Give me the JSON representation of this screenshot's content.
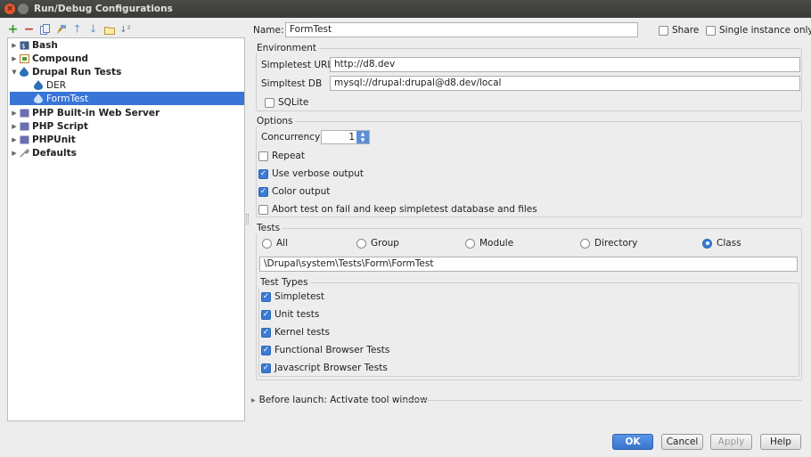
{
  "window": {
    "title": "Run/Debug Configurations"
  },
  "toolbar": {
    "icons": [
      "add-icon",
      "remove-icon",
      "copy-icon",
      "edit-defaults-icon",
      "move-up-icon",
      "move-down-icon",
      "folder-icon",
      "sort-icon"
    ]
  },
  "tree": [
    {
      "label": "Bash",
      "bold": true,
      "expanded": false,
      "level": 0
    },
    {
      "label": "Compound",
      "bold": true,
      "expanded": false,
      "level": 0
    },
    {
      "label": "Drupal Run Tests",
      "bold": true,
      "expanded": true,
      "level": 0
    },
    {
      "label": "DER",
      "bold": false,
      "level": 1
    },
    {
      "label": "FormTest",
      "bold": false,
      "level": 1,
      "selected": true
    },
    {
      "label": "PHP Built-in Web Server",
      "bold": true,
      "expanded": false,
      "level": 0
    },
    {
      "label": "PHP Script",
      "bold": true,
      "expanded": false,
      "level": 0
    },
    {
      "label": "PHPUnit",
      "bold": true,
      "expanded": false,
      "level": 0
    },
    {
      "label": "Defaults",
      "bold": true,
      "expanded": false,
      "level": 0
    }
  ],
  "name": {
    "label": "Name:",
    "value": "FormTest"
  },
  "share": {
    "label": "Share",
    "checked": false
  },
  "single_instance": {
    "label": "Single instance only",
    "checked": false
  },
  "environment": {
    "legend": "Environment",
    "url_label": "Simpletest URL",
    "url_value": "http://d8.dev",
    "db_label": "Simpltest DB",
    "db_value": "mysql://drupal:drupal@d8.dev/local",
    "sqlite_label": "SQLite",
    "sqlite_checked": false
  },
  "options": {
    "legend": "Options",
    "concurrency_label": "Concurrency",
    "concurrency_value": "1",
    "repeat": {
      "label": "Repeat",
      "checked": false
    },
    "verbose": {
      "label": "Use verbose output",
      "checked": true
    },
    "color": {
      "label": "Color output",
      "checked": true
    },
    "abort": {
      "label": "Abort test on fail and keep simpletest database and files",
      "checked": false
    }
  },
  "tests": {
    "legend": "Tests",
    "scopes": [
      {
        "label": "All",
        "selected": false
      },
      {
        "label": "Group",
        "selected": false
      },
      {
        "label": "Module",
        "selected": false
      },
      {
        "label": "Directory",
        "selected": false
      },
      {
        "label": "Class",
        "selected": true
      }
    ],
    "class_value": "\\Drupal\\system\\Tests\\Form\\FormTest",
    "types_legend": "Test Types",
    "types": [
      {
        "label": "Simpletest",
        "checked": true
      },
      {
        "label": "Unit tests",
        "checked": true
      },
      {
        "label": "Kernel tests",
        "checked": true
      },
      {
        "label": "Functional Browser Tests",
        "checked": true
      },
      {
        "label": "Javascript Browser Tests",
        "checked": true
      }
    ]
  },
  "before_launch": "Before launch: Activate tool window",
  "buttons": {
    "ok": "OK",
    "cancel": "Cancel",
    "apply": "Apply",
    "help": "Help"
  }
}
